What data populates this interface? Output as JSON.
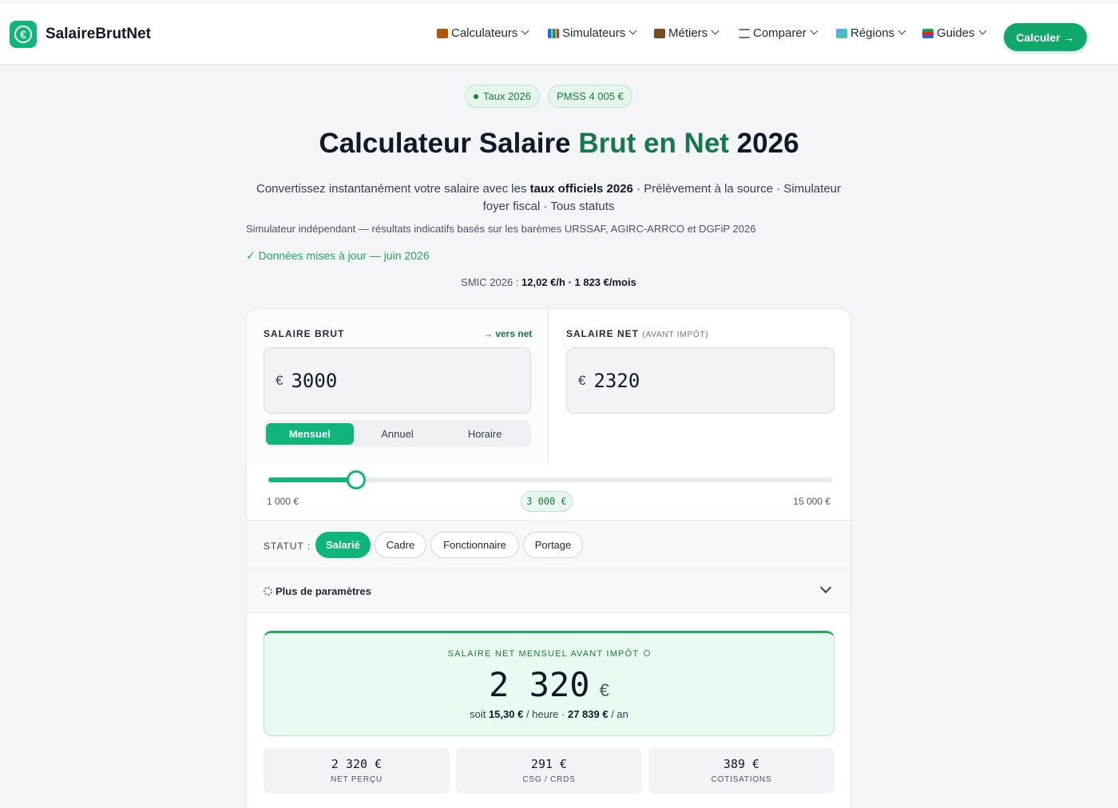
{
  "brand": {
    "name": "SalaireBrutNet",
    "logo_icon": "euro-coin-icon",
    "accent": "#10b57a"
  },
  "nav": {
    "items": [
      {
        "label": "Calculateurs",
        "icon": "abacus-icon"
      },
      {
        "label": "Simulateurs",
        "icon": "bar-chart-icon"
      },
      {
        "label": "Métiers",
        "icon": "briefcase-icon"
      },
      {
        "label": "Comparer",
        "icon": "scales-icon"
      },
      {
        "label": "Régions",
        "icon": "map-icon"
      },
      {
        "label": "Guides",
        "icon": "books-icon"
      }
    ],
    "cta": "Calculer →"
  },
  "badges": {
    "taux": "Taux 2026",
    "pmss": "PMSS 4 005 €"
  },
  "hero": {
    "title_part1": "Calculateur Salaire ",
    "title_green": "Brut en Net",
    "title_part2": " 2026",
    "lead_1": "Convertissez instantanément votre salaire avec les ",
    "lead_bold": "taux officiels 2026",
    "lead_2": " · Prélèvement à la source · Simulateur foyer fiscal · Tous statuts",
    "disclaimer": "Simulateur indépendant — résultats indicatifs basés sur les barèmes URSSAF, AGIRC-ARRCO et DGFiP 2026",
    "updated": "✓ Données mises à jour — juin 2026",
    "smic_label": "SMIC 2026 : ",
    "smic_value": "12,02 €/h · 1 823 €/mois"
  },
  "calculator": {
    "brut_label": "SALAIRE BRUT",
    "vers_net": "→ vers net",
    "brut_currency": "€",
    "brut_value": "3000",
    "net_label": "SALAIRE NET",
    "net_sub": "(AVANT IMPÔT)",
    "net_currency": "€",
    "net_value": "2320",
    "periods": [
      "Mensuel",
      "Annuel",
      "Horaire"
    ],
    "active_period": "Mensuel",
    "slider": {
      "min_label": "1 000 €",
      "max_label": "15 000 €",
      "value_label": "3 000 €",
      "min": 1000,
      "max": 15000,
      "value": 3000
    },
    "statut_label": "STATUT :",
    "statuts": [
      "Salarié",
      "Cadre",
      "Fonctionnaire",
      "Portage"
    ],
    "active_statut": "Salarié",
    "params_label": "Plus de paramètres",
    "result": {
      "label": "SALAIRE NET MENSUEL AVANT IMPÔT",
      "amount": "2 320",
      "currency": "€",
      "soit_prefix": "soit ",
      "hourly": "15,30 €",
      "hourly_suffix": " / heure · ",
      "annual": "27 839 €",
      "annual_suffix": " / an"
    },
    "tiles": [
      {
        "value": "2 320 €",
        "label": "NET PERÇU"
      },
      {
        "value": "291 €",
        "label": "CSG / CRDS"
      },
      {
        "value": "389 €",
        "label": "COTISATIONS"
      }
    ]
  }
}
